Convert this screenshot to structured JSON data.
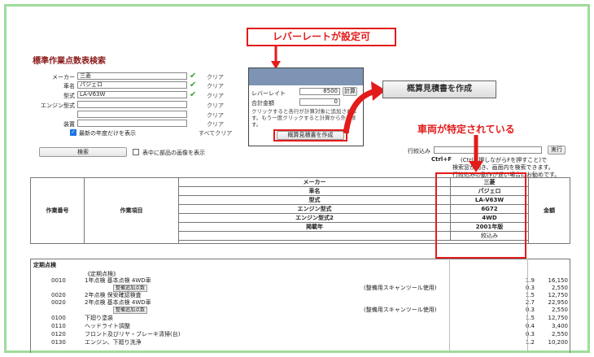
{
  "page": {
    "title": "標準作業点数表検索"
  },
  "form": {
    "rows": [
      {
        "label": "メーカー",
        "value": "三菱",
        "checked": true,
        "clear": "クリア"
      },
      {
        "label": "車名",
        "value": "パジェロ",
        "checked": true,
        "clear": "クリア"
      },
      {
        "label": "型式",
        "value": "LA-V63W",
        "checked": true,
        "clear": "クリア"
      },
      {
        "label": "エンジン型式",
        "value": "",
        "checked": false,
        "clear": "クリア"
      },
      {
        "label": "",
        "value": "",
        "checked": false,
        "clear": "クリア"
      },
      {
        "label": "装置",
        "value": "",
        "checked": false,
        "clear": "クリア"
      }
    ],
    "latest_year_label": "最新の年度だけを表示",
    "clear_all": "すべてクリア",
    "search_button": "検索",
    "show_parts_images_label": "表中に部品の画像を表示"
  },
  "callouts": {
    "lever_rate_settable": "レバーレートが設定可",
    "estimate_button_zoom": "概算見積書を作成",
    "vehicle_identified": "車両が特定されている"
  },
  "popup": {
    "lever_rate_label": "レバーレイト",
    "lever_rate_value": "8500",
    "lever_rate_btn": "計算",
    "total_points_label": "合計金額",
    "total_points_value": "0",
    "help_text": "クリックすると各行が計算対象に追加されます。もう一度クリックすると計算から外れます。",
    "create_estimate_button": "概算見積書を作成"
  },
  "filter": {
    "label": "行絞込み",
    "execute_button": "実行",
    "hint_shortcut": "Ctrl+F",
    "hint_text_1": "(Ctrlを押しながらFを押すこと)で",
    "hint_text_2": "検索窓が開き、画面内を検索できます。",
    "hint_text_3": "行絞込みの動作が遅い場合にお勧めです。"
  },
  "table": {
    "col_work_no": "作業番号",
    "col_work_item": "作業項目",
    "col_amount": "金額",
    "vehicle_rows": [
      {
        "label": "メーカー",
        "value": "三菱"
      },
      {
        "label": "車名",
        "value": "パジェロ"
      },
      {
        "label": "型式",
        "value": "LA-V63W"
      },
      {
        "label": "エンジン型式",
        "value": "6G72"
      },
      {
        "label": "エンジン型式2",
        "value": "4WD"
      },
      {
        "label": "掲載年",
        "value": "2001年版"
      }
    ],
    "narrow_label": "絞込み",
    "section": "定期点検",
    "group": "《定期点検》",
    "rows": [
      {
        "no": "0010",
        "item": "1年点検 基本点検 4WD車",
        "note": "",
        "points": "1.9",
        "amount": "16,150",
        "btn": ""
      },
      {
        "no": "",
        "item": "",
        "note": "(整備用スキャンツール使用)",
        "points": "0.3",
        "amount": "2,550",
        "btn": "整備追加点数"
      },
      {
        "no": "0020",
        "item": "2年点検 保安確認検査",
        "note": "",
        "points": "1.5",
        "amount": "12,750",
        "btn": ""
      },
      {
        "no": "0020",
        "item": "2年点検 基本点検 4WD車",
        "note": "",
        "points": "2.7",
        "amount": "22,950",
        "btn": ""
      },
      {
        "no": "",
        "item": "",
        "note": "(整備用スキャンツール使用)",
        "points": "0.3",
        "amount": "2,550",
        "btn": "整備追加点数"
      },
      {
        "no": "0100",
        "item": "下廻り塗装",
        "note": "",
        "points": "1.5",
        "amount": "12,750",
        "btn": ""
      },
      {
        "no": "0110",
        "item": "ヘッドライト調整",
        "note": "",
        "points": "0.4",
        "amount": "3,400",
        "btn": ""
      },
      {
        "no": "0120",
        "item": "フロント及びリヤ・ブレーキ清掃(台)",
        "note": "",
        "points": "0.3",
        "amount": "2,550",
        "btn": ""
      },
      {
        "no": "0130",
        "item": "エンジン、下廻り洗浄",
        "note": "",
        "points": "1.2",
        "amount": "10,200",
        "btn": ""
      }
    ]
  }
}
